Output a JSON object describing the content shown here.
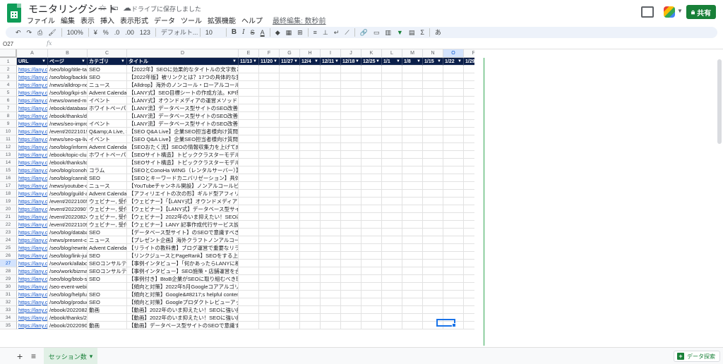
{
  "app": {
    "doc_title": "モニタリングシート",
    "saved_label": "ドライブに保存しました",
    "share_label": "共有",
    "star_icon": "star-icon",
    "folder_icon": "folder-icon",
    "cloud_icon": "cloud-done-icon"
  },
  "menu": {
    "items": [
      "ファイル",
      "編集",
      "表示",
      "挿入",
      "表示形式",
      "データ",
      "ツール",
      "拡張機能",
      "ヘルプ"
    ],
    "last_edit": "最終編集: 数秒前"
  },
  "toolbar": {
    "undo": "↶",
    "redo": "↷",
    "print": "⎙",
    "paint_format": "🖌",
    "zoom": "100%",
    "currency": "¥",
    "percent": "%",
    "decimal_decrease": ".0",
    "decimal_increase": ".00",
    "number_format": "123",
    "font_name": "デフォルト...",
    "font_size": "10",
    "bold": "B",
    "italic": "I",
    "strike": "S",
    "text_color": "A",
    "fill_color": "◆",
    "borders": "▦",
    "merge": "⊞",
    "halign": "≡",
    "valign": "⊥",
    "wrap": "↵",
    "rotate": "⟋",
    "link": "🔗",
    "comment": "▭",
    "chart": "▥",
    "filter": "▼",
    "views": "▤",
    "functions": "Σ",
    "input_tools": "あ"
  },
  "formula_bar": {
    "name_box": "O27",
    "fx_label": "fx"
  },
  "columns": [
    {
      "letter": "A",
      "header": "URL"
    },
    {
      "letter": "B",
      "header": "ページ"
    },
    {
      "letter": "C",
      "header": "カテゴリ"
    },
    {
      "letter": "D",
      "header": "タイトル"
    },
    {
      "letter": "E",
      "header": "11/13"
    },
    {
      "letter": "F",
      "header": "11/20"
    },
    {
      "letter": "G",
      "header": "11/27"
    },
    {
      "letter": "H",
      "header": "12/4"
    },
    {
      "letter": "I",
      "header": "12/11"
    },
    {
      "letter": "J",
      "header": "12/18"
    },
    {
      "letter": "K",
      "header": "12/25"
    },
    {
      "letter": "L",
      "header": "1/1"
    },
    {
      "letter": "M",
      "header": "1/8"
    },
    {
      "letter": "N",
      "header": "1/15"
    },
    {
      "letter": "O",
      "header": "1/22"
    },
    {
      "letter": "P",
      "header": "1/29"
    }
  ],
  "rows": [
    {
      "n": "2",
      "url": "https://lany.c",
      "page": "/seo/blog/title-tag",
      "cat": "SEO",
      "title": "【2022年】SEOに効果的なタイトルの文字数と"
    },
    {
      "n": "3",
      "url": "https://lany.c",
      "page": "/seo/blog/backlin",
      "cat": "SEO",
      "title": "【2022年版】被リンクとは？17つの具体的な獲"
    },
    {
      "n": "4",
      "url": "https://lany.c",
      "page": "/news/alldrop-no",
      "cat": "ニュース",
      "title": "【Alldrop】海外のノンコール・ローアルコール"
    },
    {
      "n": "5",
      "url": "https://lany.c",
      "page": "/seo/blog/kpi-she",
      "cat": "Advent Calendar",
      "title": "【LANY式】SEO目標シートの作成方法。KPI策"
    },
    {
      "n": "6",
      "url": "https://lany.c",
      "page": "/news/owned-me",
      "cat": "イベント",
      "title": "【LANY式】オウンドメディアの運営メソッドを"
    },
    {
      "n": "7",
      "url": "https://lany.c",
      "page": "/ebook/database",
      "cat": "ホワイトペーパー",
      "title": "【LANY流】データベース型サイトのSEO改善メ"
    },
    {
      "n": "8",
      "url": "https://lany.c",
      "page": "/ebook/thanks/d",
      "cat": "",
      "title": "【LANY流】データベース型サイトのSEO改善メ"
    },
    {
      "n": "9",
      "url": "https://lany.c",
      "page": "/news/seo-impro",
      "cat": "イベント",
      "title": "【LANY流】データベース型サイトのSEO改善メ"
    },
    {
      "n": "10",
      "url": "https://lany.c",
      "page": "/event/20221019",
      "cat": "Q&amp;A Live, S",
      "title": "【SEO Q&A Live】企業SEO担当者様向け質問会"
    },
    {
      "n": "11",
      "url": "https://lany.c",
      "page": "/news/seo-qa-liv",
      "cat": "イベント",
      "title": "【SEO Q&A Live】企業SEO担当者様向け質問会"
    },
    {
      "n": "12",
      "url": "https://lany.c",
      "page": "/seo/blog/informa",
      "cat": "Advent Calendar",
      "title": "【SEOおたく流】SEOの情報収集力を上げて成"
    },
    {
      "n": "13",
      "url": "https://lany.c",
      "page": "/ebook/topic-clus",
      "cat": "ホワイトペーパー",
      "title": "【SEOサイト構造】トピッククラスターモデル"
    },
    {
      "n": "14",
      "url": "https://lany.c",
      "page": "/ebook/thanks/to",
      "cat": "",
      "title": "【SEOサイト構造】トピッククラスターモデル"
    },
    {
      "n": "15",
      "url": "https://lany.c",
      "page": "/seo/blog/conoha",
      "cat": "コラム",
      "title": "【SEOとConoHa WING（レンタルサーバー）】"
    },
    {
      "n": "16",
      "url": "https://lany.c",
      "page": "/seo/blog/cannib",
      "cat": "SEO",
      "title": "【SEOとキーワードカニバリゼーション】具体"
    },
    {
      "n": "17",
      "url": "https://lany.c",
      "page": "/news/youtube-c",
      "cat": "ニュース",
      "title": "【YouTubeチャンネル開設】ノンアルコールビー"
    },
    {
      "n": "18",
      "url": "https://lany.c",
      "page": "/seo/blog/guild-a",
      "cat": "Advent Calendar",
      "title": "【アフィリエイトの次の形】ギルド型アフィリ"
    },
    {
      "n": "19",
      "url": "https://lany.c",
      "page": "/event/20221005",
      "cat": "ウェビナー, 受付",
      "title": "【ウェビナー】「【LANY式】オウンドメディア"
    },
    {
      "n": "20",
      "url": "https://lany.c",
      "page": "/event/20220907",
      "cat": "ウェビナー, 受付",
      "title": "【ウェビナー】【LANY式】データベース型サイ"
    },
    {
      "n": "21",
      "url": "https://lany.c",
      "page": "/event/20220824",
      "cat": "ウェビナー, 受付",
      "title": "【ウェビナー】2022年のいま抑えたい！SEOに"
    },
    {
      "n": "22",
      "url": "https://lany.c",
      "page": "/event/20221109",
      "cat": "ウェビナー, 受付",
      "title": "【ウェビナー】LANY 記事作成代行サービス説"
    },
    {
      "n": "23",
      "url": "https://lany.c",
      "page": "/seo/blog/databa",
      "cat": "SEO",
      "title": "【データベース型サイト】のSEOで意識すべき"
    },
    {
      "n": "24",
      "url": "https://lany.c",
      "page": "/news/present-ca",
      "cat": "ニュース",
      "title": "【プレゼント企画】海外クラフトノンアルコー"
    },
    {
      "n": "25",
      "url": "https://lany.c",
      "page": "/seo/blog/rewrite",
      "cat": "Advent Calendar",
      "title": "【リライトの教科書】ブログ運営で重要なリラ"
    },
    {
      "n": "26",
      "url": "https://lany.c",
      "page": "/seo/blog/link-jui",
      "cat": "SEO",
      "title": "【リンクジュースとPageRank】SEOをする上で"
    },
    {
      "n": "27",
      "url": "https://lany.c",
      "page": "/seo/work/allabo",
      "cat": "SEOコンサルティ",
      "title": "【事例インタビュー】「何かあったらLANYに相"
    },
    {
      "n": "28",
      "url": "https://lany.c",
      "page": "/seo/work/bizma",
      "cat": "SEOコンサルティ",
      "title": "【事例インタビュー】SEO施策・店舗運営を合"
    },
    {
      "n": "29",
      "url": "https://lany.c",
      "page": "/seo/blog/btob-se",
      "cat": "SEO",
      "title": "【事例付き】BtoB企業がSEOに取り組むべき理"
    },
    {
      "n": "30",
      "url": "https://lany.c",
      "page": "/seo-event-webin",
      "cat": "",
      "title": "【傾向と対策】2022年5月Googleコアアルゴリズ"
    },
    {
      "n": "31",
      "url": "https://lany.c",
      "page": "/seo/blog/helpful",
      "cat": "SEO",
      "title": "【傾向と対策】Google&#8217;s helpful content"
    },
    {
      "n": "32",
      "url": "https://lany.c",
      "page": "/seo/blog/produc",
      "cat": "SEO",
      "title": "【傾向と対策】Googleプロダクトレビューアッ"
    },
    {
      "n": "33",
      "url": "https://lany.c",
      "page": "/ebook/2022082",
      "cat": "動画",
      "title": "【動画】2022年のいま抑えたい！SEOに強い記"
    },
    {
      "n": "34",
      "url": "https://lany.c",
      "page": "/ebook/thanks/20",
      "cat": "",
      "title": "【動画】2022年のいま抑えたい！SEOに強い記"
    },
    {
      "n": "35",
      "url": "https://lany.c",
      "page": "/ebook/2022090",
      "cat": "動画",
      "title": "【動画】データベース型サイトのSEOで意識す"
    }
  ],
  "bottom": {
    "add_sheet": "+",
    "sheets_menu": "≡",
    "active_sheet": "セッション数",
    "explore_label": "データ探索"
  }
}
